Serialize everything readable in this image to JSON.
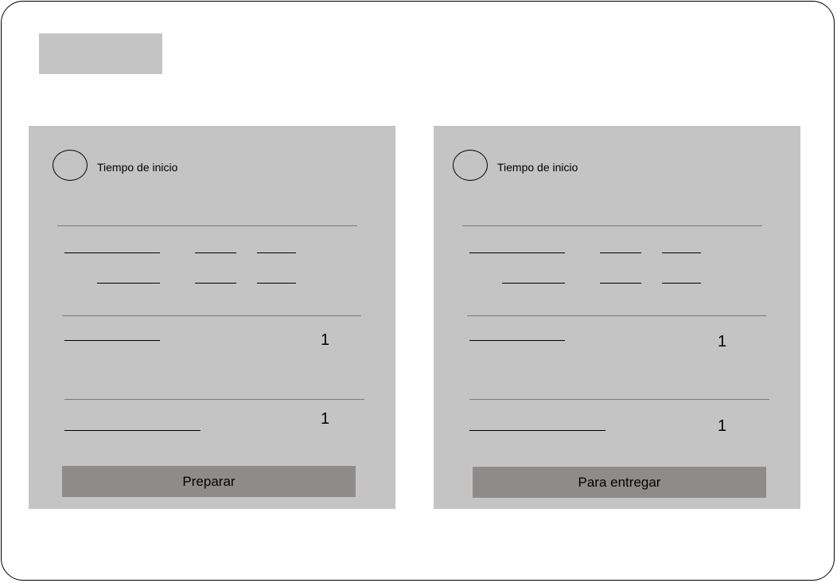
{
  "cards": [
    {
      "timer_label": "Tiempo de inicio",
      "items": [
        {
          "quantity": "1"
        },
        {
          "quantity": "1"
        }
      ],
      "action_label": "Preparar"
    },
    {
      "timer_label": "Tiempo de inicio",
      "items": [
        {
          "quantity": "1"
        },
        {
          "quantity": "1"
        }
      ],
      "action_label": "Para entregar"
    }
  ],
  "colors": {
    "panel": "#c4c4c4",
    "button": "#908b8b",
    "background": "#ffffff"
  }
}
